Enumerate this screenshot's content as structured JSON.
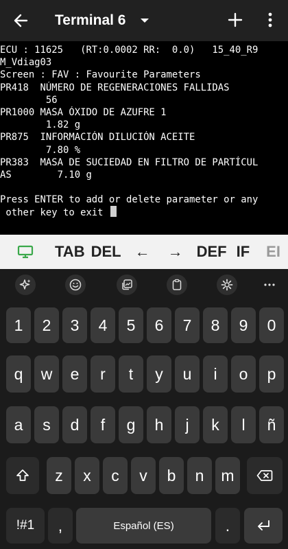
{
  "appbar": {
    "title": "Terminal 6"
  },
  "terminal": {
    "lines": [
      "ECU : 11625   (RT:0.0002 RR:  0.0)   15_40_R9",
      "M_Vdiag03",
      "Screen : FAV : Favourite Parameters",
      "PR418  NÚMERO DE REGENERACIONES FALLIDAS",
      "        56",
      "PR1000 MASA ÓXIDO DE AZUFRE 1",
      "        1.82 g",
      "PR875  INFORMACIÓN DILUCIÓN ACEITE",
      "        7.80 %",
      "PR383  MASA DE SUCIEDAD EN FILTRO DE PARTÍCUL",
      "AS        7.10 g",
      "",
      "Press ENTER to add or delete parameter or any",
      " other key to exit "
    ]
  },
  "extra_keys": {
    "tab": "TAB",
    "del": "DEL",
    "left": "←",
    "right": "→",
    "def": "DEF",
    "if": "IF",
    "partial": "EI"
  },
  "keyboard": {
    "row1": [
      "1",
      "2",
      "3",
      "4",
      "5",
      "6",
      "7",
      "8",
      "9",
      "0"
    ],
    "row2": [
      "q",
      "w",
      "e",
      "r",
      "t",
      "y",
      "u",
      "i",
      "o",
      "p"
    ],
    "row3": [
      "a",
      "s",
      "d",
      "f",
      "g",
      "h",
      "j",
      "k",
      "l",
      "ñ"
    ],
    "row4": [
      "z",
      "x",
      "c",
      "v",
      "b",
      "n",
      "m"
    ],
    "symbols": "!#1",
    "comma": ",",
    "space": "Español (ES)",
    "period": "."
  }
}
